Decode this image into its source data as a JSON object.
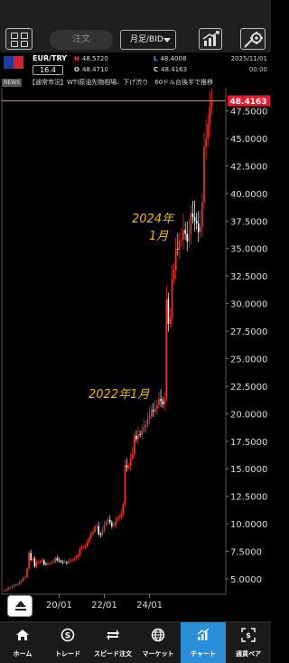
{
  "toolbar": {
    "order_label": "注文",
    "period_label": "月足/BID"
  },
  "quote": {
    "pair": "EUR/TRY",
    "spread": "16.4",
    "high_label": "H",
    "high": "48.5720",
    "open_label": "O",
    "open": "48.4710",
    "low_label": "L",
    "low": "48.4008",
    "close_label": "C",
    "close": "48.4163",
    "date": "2025/11/01",
    "time": "00:00"
  },
  "news": {
    "tag": "NEWS",
    "headline": "【通常市況】WTI原油先物相場、下げ渋り　60ドル台後半で推移"
  },
  "chart_data": {
    "type": "candlestick",
    "pair": "EUR/TRY",
    "timeframe": "月足",
    "current_price": "48.4163",
    "y_ticks": [
      "47.5000",
      "45.0000",
      "42.5000",
      "40.0000",
      "37.5000",
      "35.0000",
      "32.5000",
      "30.0000",
      "27.5000",
      "25.0000",
      "22.5000",
      "20.0000",
      "17.5000",
      "15.0000",
      "12.5000",
      "10.0000",
      "7.5000",
      "5.0000"
    ],
    "x_ticks": [
      "20/01",
      "22/01",
      "24/01"
    ],
    "ylim": [
      3.6,
      49.6
    ],
    "annotations": [
      {
        "text": "2024年",
        "text2": "1月"
      },
      {
        "text": "2022年1月"
      }
    ],
    "closes": [
      3.93,
      4.03,
      4.16,
      4.21,
      4.32,
      4.36,
      4.47,
      4.51,
      4.69,
      4.83,
      5.11,
      5.15,
      5.92,
      7.35,
      6.7,
      6.84,
      6.12,
      6.47,
      6.55,
      6.57,
      6.68,
      6.33,
      6.31,
      6.4,
      6.4,
      6.48,
      6.55,
      6.89,
      6.68,
      6.62,
      6.53,
      6.5,
      6.51,
      6.43,
      6.6,
      6.66,
      6.73,
      6.85,
      6.95,
      7.15,
      7.75,
      7.83,
      7.87,
      7.95,
      8.34,
      8.72,
      9.13,
      9.27,
      9.75,
      9.77,
      9.06,
      8.98,
      9.43,
      9.89,
      10.16,
      10.36,
      10.11,
      9.79,
      9.84,
      10.27,
      10.54,
      10.61,
      10.9,
      11.76,
      15.32,
      15.12,
      15.22,
      15.95,
      16.32,
      17.98,
      17.68,
      18.12,
      18.09,
      18.46,
      18.75,
      18.98,
      19.53,
      19.82,
      20.35,
      20.2,
      20.46,
      20.81,
      21.35,
      21.14,
      20.83,
      21.34,
      30.4,
      28.16,
      28.74,
      32.24,
      33.02,
      34.97,
      34.9,
      35.71,
      35.82,
      36.68,
      36.35,
      35.65,
      36.26,
      38.19,
      37.83,
      37.51,
      37.28,
      36.49,
      36.97,
      39.23,
      44.21,
      44.95,
      46.31,
      47.86,
      48.42
    ]
  },
  "nav": {
    "items": [
      {
        "label": "ホーム"
      },
      {
        "label": "トレード"
      },
      {
        "label": "スピード注文"
      },
      {
        "label": "マーケット"
      },
      {
        "label": "チャート"
      },
      {
        "label": "通貨ペア"
      }
    ]
  },
  "colors": {
    "up": "#f03a2e",
    "down": "#ffffff",
    "price_box": "#e8182c",
    "price_line": "#e3a33a",
    "annotation": "#f2b705",
    "active_tab": "#2a8fd6"
  }
}
